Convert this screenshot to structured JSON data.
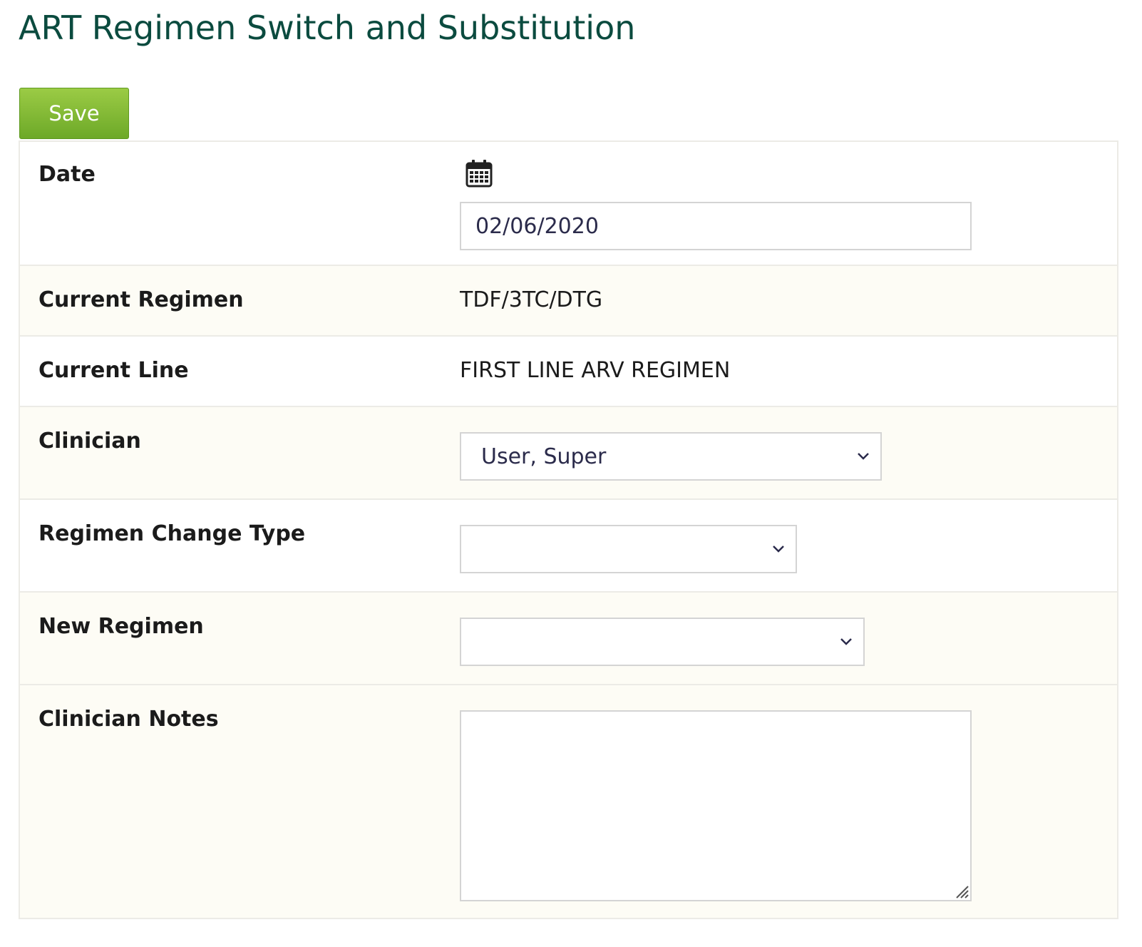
{
  "page": {
    "title": "ART Regimen Switch and Substitution"
  },
  "toolbar": {
    "save_label": "Save"
  },
  "form": {
    "date": {
      "label": "Date",
      "value": "02/06/2020",
      "icon": "calendar-icon"
    },
    "current_regimen": {
      "label": "Current Regimen",
      "value": "TDF/3TC/DTG"
    },
    "current_line": {
      "label": "Current Line",
      "value": "FIRST LINE ARV REGIMEN"
    },
    "clinician": {
      "label": "Clinician",
      "selected": "User, Super",
      "icon": "chevron-down-icon"
    },
    "regimen_change_type": {
      "label": "Regimen Change Type",
      "selected": "",
      "icon": "chevron-down-icon"
    },
    "new_regimen": {
      "label": "New Regimen",
      "selected": "",
      "icon": "chevron-down-icon"
    },
    "clinician_notes": {
      "label": "Clinician Notes",
      "value": ""
    }
  },
  "colors": {
    "title": "#0b4b3f",
    "save_button_top": "#9bcb45",
    "save_button_bottom": "#6da928",
    "row_alt_background": "#fdfcf5",
    "border": "#ecebe6",
    "input_text": "#2b2b4b"
  }
}
